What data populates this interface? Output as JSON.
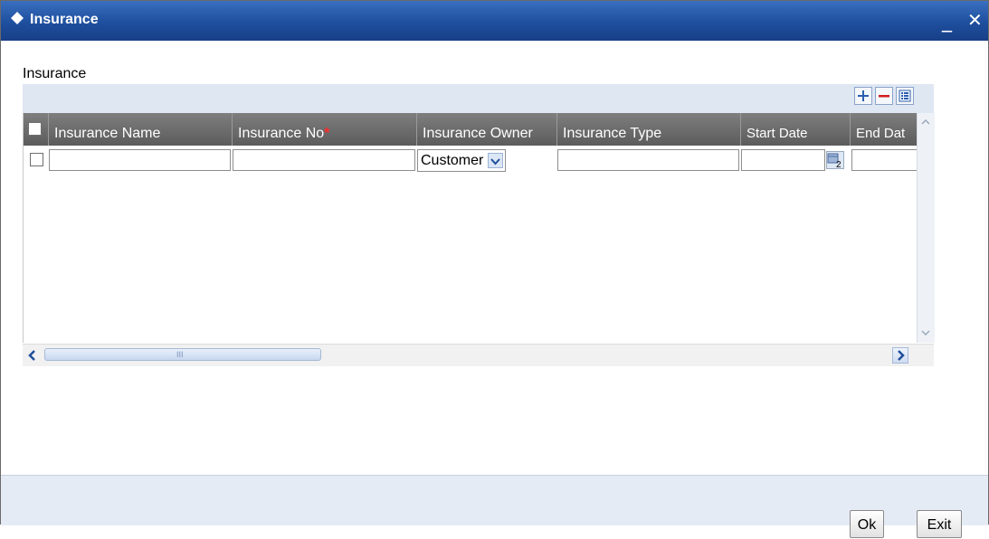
{
  "window": {
    "title": "Insurance",
    "minimize_label": "_",
    "close_label": "✕"
  },
  "section": {
    "title": "Insurance"
  },
  "toolbar": {
    "add_icon": "plus-icon",
    "remove_icon": "minus-icon",
    "view_icon": "list-view-icon"
  },
  "table": {
    "columns": [
      {
        "label": "Insurance Name",
        "required": false
      },
      {
        "label": "Insurance No",
        "required": true,
        "required_mark": "*"
      },
      {
        "label": "Insurance Owner",
        "required": false
      },
      {
        "label": "Insurance Type",
        "required": false
      },
      {
        "label": "Start Date",
        "required": false
      },
      {
        "label": "End Dat",
        "required": false
      }
    ],
    "rows": [
      {
        "insurance_name": "",
        "insurance_no": "",
        "insurance_owner": "Customer",
        "insurance_type": "",
        "start_date": "",
        "end_date": ""
      }
    ],
    "calendar_badge": "2"
  },
  "scrollbar": {
    "left_arrow": "‹",
    "right_arrow": "›",
    "grip": "III"
  },
  "footer": {
    "ok_label": "Ok",
    "exit_label": "Exit"
  },
  "colors": {
    "title_bar": "#1e4f9e",
    "header_bg": "#6a6a6a",
    "required": "#ff2a2a",
    "toolbar_strip": "#dfe7f3"
  }
}
